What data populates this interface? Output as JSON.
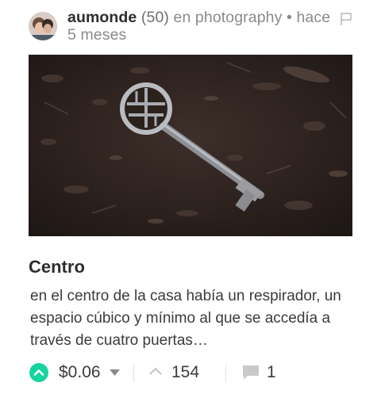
{
  "post": {
    "author": "aumonde",
    "reputation": "(50)",
    "category_prefix": "en photography",
    "separator": "•",
    "time_line1": "hace",
    "time_line2": "5 meses",
    "title": "Centro",
    "excerpt": "en el centro de la casa había un respirador, un espacio cúbico y mínimo al que se accedía a través de cuatro puertas…"
  },
  "footer": {
    "payout": "$0.06",
    "votes": "154",
    "comments": "1"
  },
  "colors": {
    "accent": "#17d3a0",
    "text": "#333333",
    "muted": "#8a8a8a"
  },
  "icons": {
    "flag": "flag-icon",
    "upvote": "upvote-icon",
    "caret": "chevron-down-icon",
    "vote_count": "chevron-up-icon",
    "comment": "comment-icon"
  }
}
